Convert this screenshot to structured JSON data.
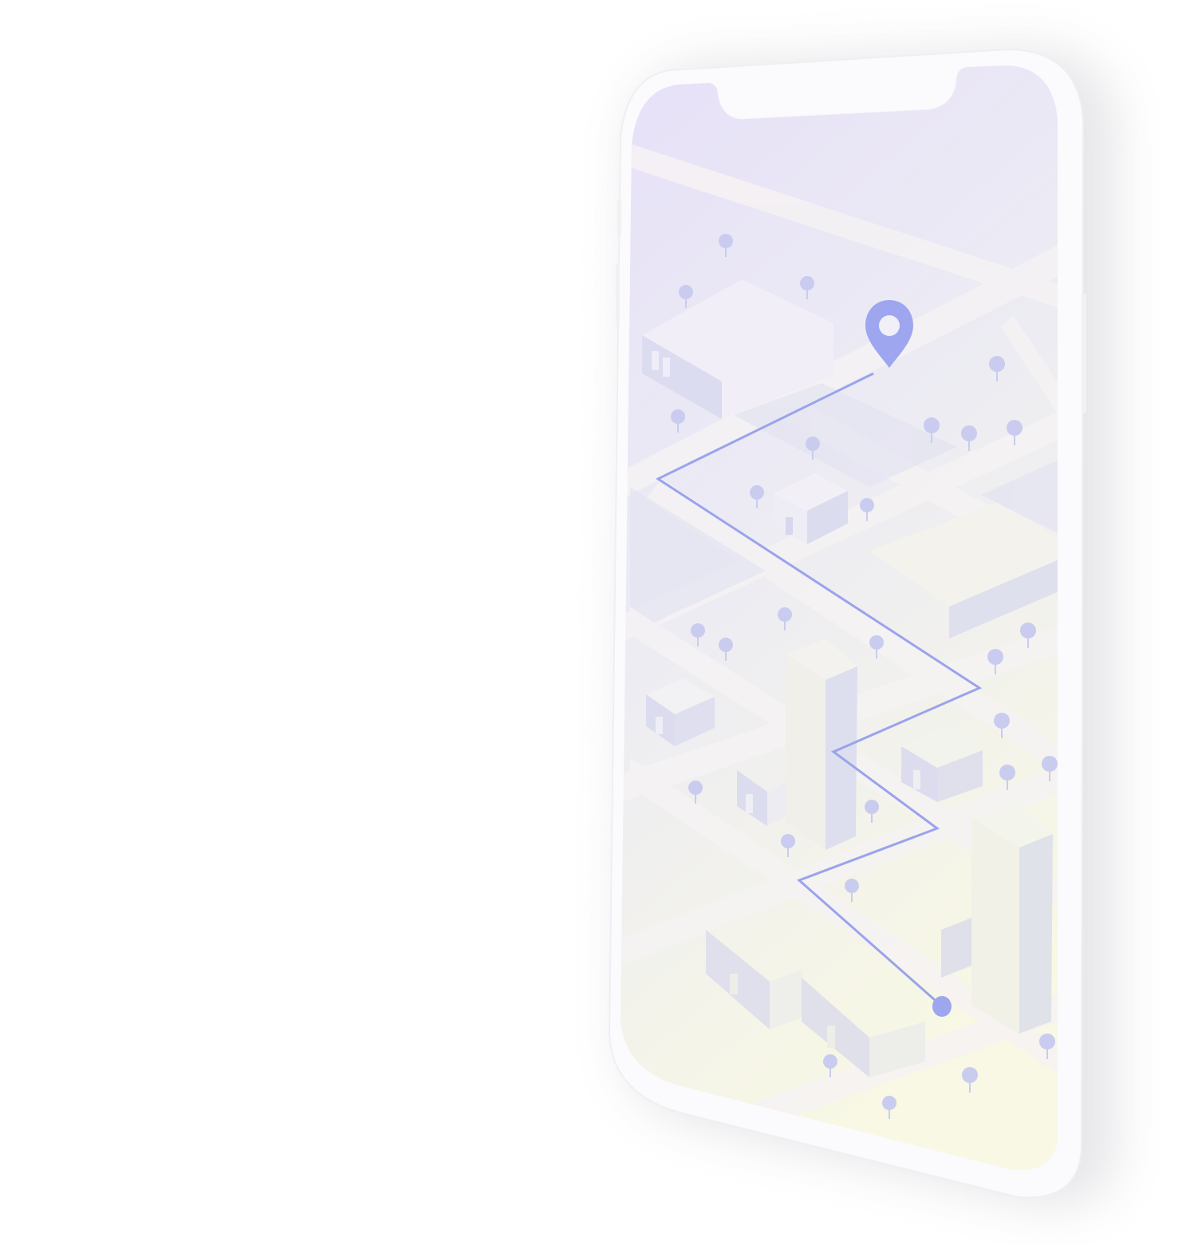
{
  "device": "smartphone",
  "screen": "map-navigation",
  "colors": {
    "route": "#9aa3ec",
    "pin": "#9da6ee",
    "tree": "#c9ccef",
    "building_face": "#dfe0f3",
    "building_top": "#f1eef7",
    "screen_top": "#e8e3f8",
    "screen_bottom": "#f7f7e6",
    "frame": "#fbfbfd"
  },
  "icons": {
    "destination": "location-pin-icon",
    "origin": "start-dot-icon"
  }
}
